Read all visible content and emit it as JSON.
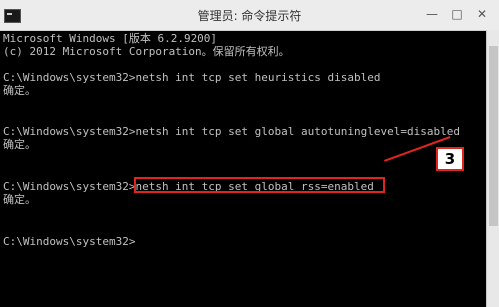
{
  "window": {
    "title": "管理员: 命令提示符",
    "minimize_glyph": "—",
    "maximize_glyph": "□",
    "close_glyph": "✕",
    "icon": "cmd-icon"
  },
  "console": {
    "lines": [
      "Microsoft Windows [版本 6.2.9200]",
      "(c) 2012 Microsoft Corporation。保留所有权利。",
      "C:\\Windows\\system32>netsh int tcp set heuristics disabled",
      "确定。",
      "C:\\Windows\\system32>netsh int tcp set global autotuninglevel=disabled",
      "确定。",
      "C:\\Windows\\system32>netsh int tcp set global rss=enabled",
      "确定。",
      "C:\\Windows\\system32>"
    ]
  },
  "annotation": {
    "callout_number": "3",
    "color": "#e0251f"
  }
}
